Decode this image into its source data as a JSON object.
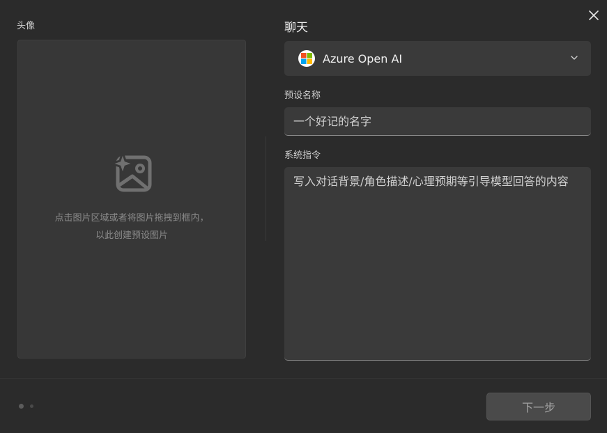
{
  "avatar": {
    "label": "头像",
    "hint_line1": "点击图片区域或者将图片拖拽到框内，",
    "hint_line2": "以此创建预设图片",
    "icon": "image-sparkle-icon"
  },
  "chat": {
    "title": "聊天",
    "provider": {
      "selected": "Azure Open AI",
      "icon": "microsoft-logo-icon"
    }
  },
  "preset_name": {
    "label": "预设名称",
    "placeholder": "一个好记的名字"
  },
  "system_instruction": {
    "label": "系统指令",
    "placeholder": "写入对话背景/角色描述/心理预期等引导模型回答的内容"
  },
  "footer": {
    "next_label": "下一步",
    "pages": 2,
    "current_page": 1
  },
  "colors": {
    "background": "#2b2b2b",
    "panel": "#373737",
    "input": "#3a3a3a",
    "button_disabled": "#4a4a4a"
  }
}
